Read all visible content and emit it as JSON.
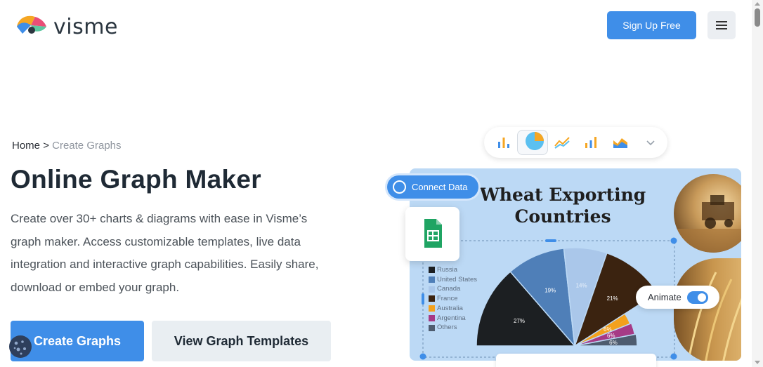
{
  "header": {
    "logo_text": "visme",
    "signup_label": "Sign Up Free"
  },
  "breadcrumb": {
    "home": "Home",
    "separator": ">",
    "current": "Create Graphs"
  },
  "hero": {
    "title": "Online Graph Maker",
    "description": "Create over 30+ charts & diagrams with ease in Visme’s graph maker. Access customizable templates, live data integration and interactive graph capabilities. Easily share, download or embed your graph.",
    "primary_button": "Create Graphs",
    "secondary_button": "View Graph Templates"
  },
  "illustration": {
    "connect_label": "Connect Data",
    "animate_label": "Animate",
    "animate_on": true,
    "toolbar_icons": [
      "bar-chart-icon",
      "pie-chart-icon",
      "line-chart-icon",
      "column-chart-icon",
      "area-chart-icon",
      "chevron-down-icon"
    ]
  },
  "chart_data": {
    "type": "pie",
    "title": "Wheat Exporting Countries",
    "legend_placement": "left",
    "categories": [
      "Russia",
      "United States",
      "Canada",
      "France",
      "Australia",
      "Argentina",
      "Others"
    ],
    "colors": [
      "#1c1f22",
      "#4f7fb8",
      "#aac7ea",
      "#3b2310",
      "#f3a11d",
      "#a63a86",
      "#4e5c6f"
    ],
    "slices": [
      {
        "label": "27%",
        "value": 27
      },
      {
        "label": "19%",
        "value": 19
      },
      {
        "label": "14%",
        "value": 14
      },
      {
        "label": "21%",
        "value": 21
      },
      {
        "label": "6%",
        "value": 6
      },
      {
        "label": "6%",
        "value": 6
      },
      {
        "label": "6%",
        "value": 6
      }
    ]
  },
  "colors": {
    "accent": "#3f8ee8",
    "panel_bg": "#bcd9f5",
    "secondary_btn_bg": "#e9eef2"
  }
}
